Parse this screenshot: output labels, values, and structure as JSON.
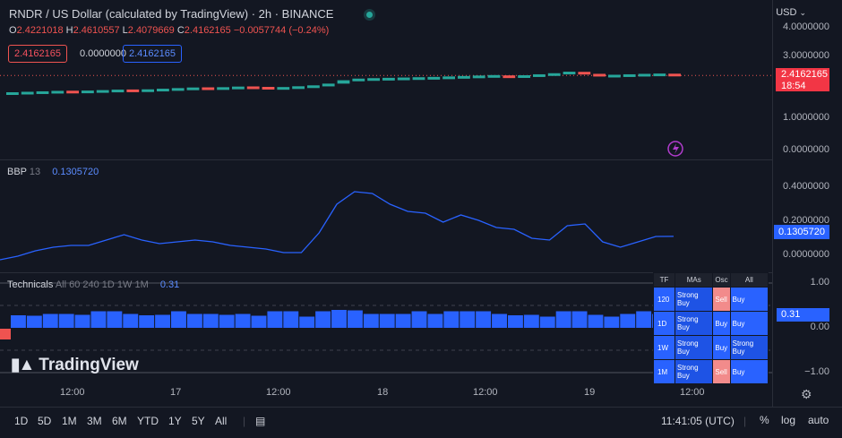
{
  "header": {
    "title": "RNDR / US Dollar (calculated by TradingView) · 2h · BINANCE",
    "ohlc": {
      "o_label": "O",
      "o": "2.4221018",
      "h_label": "H",
      "h": "2.4610557",
      "l_label": "L",
      "l": "2.4079669",
      "c_label": "C",
      "c": "2.4162165",
      "change": "−0.0057744 (−0.24%)"
    },
    "price_boxes": {
      "bid": "2.4162165",
      "spread": "0.0000000",
      "ask": "2.4162165"
    },
    "currency": "USD"
  },
  "price_axis": {
    "labels": [
      "4.0000000",
      "3.0000000",
      "2.0000000",
      "1.0000000",
      "0.0000000"
    ],
    "last_price": "2.4162165",
    "countdown": "18:54"
  },
  "bbp_pane": {
    "name": "BBP",
    "param": "13",
    "value": "0.1305720",
    "axis": [
      "0.4000000",
      "0.2000000",
      "0.0000000"
    ],
    "last_value": "0.1305720"
  },
  "technicals_pane": {
    "name": "Technicals",
    "params": "All 60 240 1D 1W 1M",
    "value": "0.31",
    "axis": [
      "1.00",
      "0.00",
      "−1.00"
    ],
    "last_value": "0.31",
    "table": {
      "headers": [
        "TF",
        "MAs",
        "Osc",
        "All"
      ],
      "rows": [
        {
          "tf": "120",
          "mas": "Strong Buy",
          "osc": "Sell",
          "all": "Buy"
        },
        {
          "tf": "1D",
          "mas": "Strong Buy",
          "osc": "Buy",
          "all": "Buy"
        },
        {
          "tf": "1W",
          "mas": "Strong Buy",
          "osc": "Buy",
          "all": "Strong Buy"
        },
        {
          "tf": "1M",
          "mas": "Strong Buy",
          "osc": "Sell",
          "all": "Buy"
        }
      ]
    }
  },
  "time_axis": [
    "12:00",
    "17",
    "12:00",
    "18",
    "12:00",
    "19",
    "12:00"
  ],
  "watermark": "TradingView",
  "bottom_bar": {
    "timeframes": [
      "1D",
      "5D",
      "1M",
      "3M",
      "6M",
      "YTD",
      "1Y",
      "5Y",
      "All"
    ],
    "clock": "11:41:05 (UTC)",
    "percent": "%",
    "log": "log",
    "auto": "auto"
  },
  "colors": {
    "up": "#26a69a",
    "down": "#ef5350",
    "bbp_line": "#2962ff",
    "tech_bar": "#2962ff",
    "background": "#131722"
  },
  "chart_data": [
    {
      "type": "candlestick",
      "title": "RNDR / US Dollar (calculated by TradingView) · 2h · BINANCE",
      "ylim": [
        0,
        4
      ],
      "last": 2.4162165,
      "closes": [
        1.83,
        1.85,
        1.86,
        1.88,
        1.87,
        1.89,
        1.9,
        1.92,
        1.91,
        1.93,
        1.95,
        1.97,
        1.99,
        1.98,
        2.0,
        2.02,
        2.01,
        1.99,
        2.0,
        2.04,
        2.06,
        2.15,
        2.26,
        2.28,
        2.29,
        2.3,
        2.31,
        2.32,
        2.33,
        2.35,
        2.36,
        2.38,
        2.39,
        2.36,
        2.4,
        2.42,
        2.47,
        2.52,
        2.46,
        2.39,
        2.4,
        2.42,
        2.43,
        2.44,
        2.42
      ],
      "up": [
        true,
        true,
        true,
        true,
        false,
        true,
        true,
        true,
        false,
        true,
        true,
        true,
        true,
        false,
        true,
        true,
        false,
        false,
        true,
        true,
        true,
        true,
        true,
        true,
        true,
        true,
        true,
        true,
        true,
        true,
        true,
        true,
        true,
        false,
        true,
        true,
        true,
        true,
        false,
        false,
        true,
        true,
        true,
        true,
        false
      ]
    },
    {
      "type": "line",
      "name": "BBP",
      "ylim": [
        -0.05,
        0.5
      ],
      "values": [
        0.0,
        0.02,
        0.05,
        0.07,
        0.08,
        0.08,
        0.11,
        0.14,
        0.11,
        0.09,
        0.1,
        0.11,
        0.1,
        0.08,
        0.07,
        0.06,
        0.04,
        0.04,
        0.15,
        0.31,
        0.38,
        0.37,
        0.31,
        0.27,
        0.26,
        0.21,
        0.25,
        0.22,
        0.18,
        0.17,
        0.12,
        0.11,
        0.19,
        0.2,
        0.1,
        0.07,
        0.1,
        0.13,
        0.130572
      ]
    },
    {
      "type": "bar",
      "name": "Technicals",
      "ylim": [
        -1,
        1
      ],
      "values": [
        0.28,
        0.27,
        0.31,
        0.31,
        0.29,
        0.37,
        0.37,
        0.31,
        0.28,
        0.29,
        0.37,
        0.31,
        0.31,
        0.29,
        0.31,
        0.27,
        0.37,
        0.37,
        0.25,
        0.37,
        0.4,
        0.39,
        0.31,
        0.31,
        0.31,
        0.37,
        0.31,
        0.37,
        0.37,
        0.37,
        0.31,
        0.28,
        0.29,
        0.25,
        0.37,
        0.37,
        0.29,
        0.25,
        0.31,
        0.37,
        0.31
      ]
    }
  ]
}
